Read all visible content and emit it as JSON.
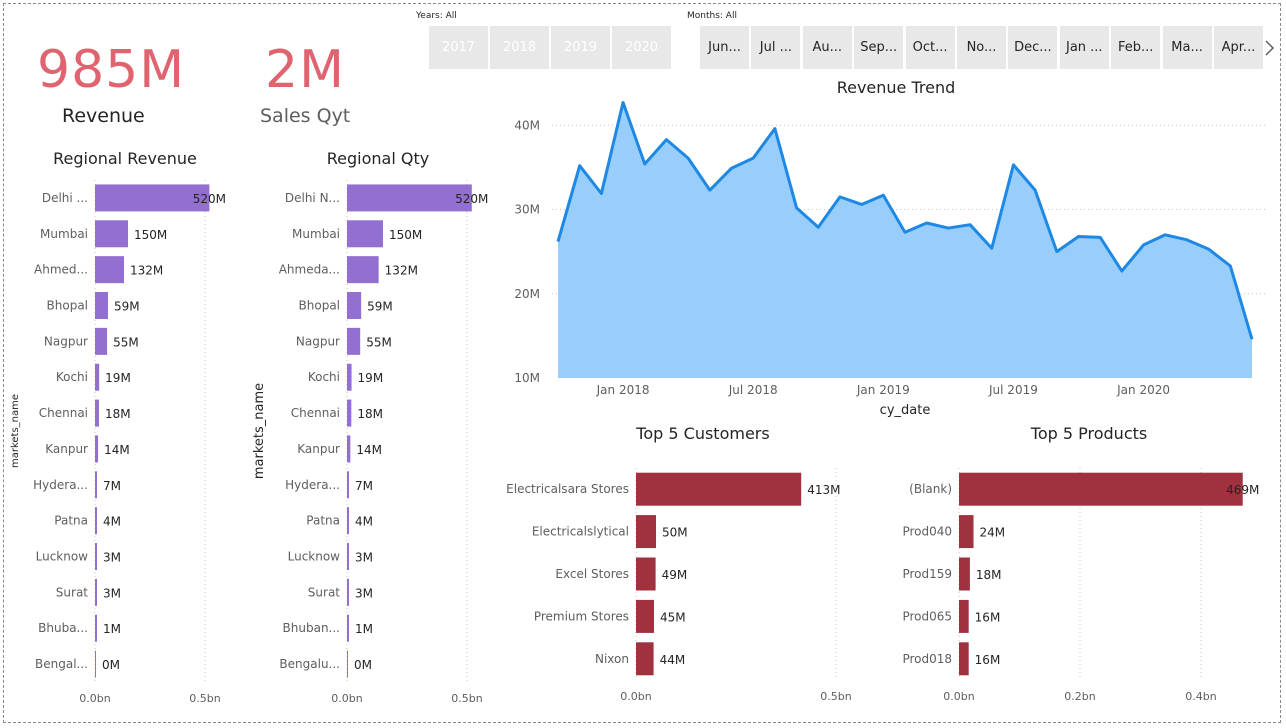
{
  "kpis": {
    "revenue": {
      "value": "985M",
      "label": "Revenue"
    },
    "sales_qty": {
      "value": "2M",
      "label": "Sales Qyt"
    }
  },
  "slicers": {
    "years": {
      "title": "Years: All",
      "items": [
        "2017",
        "2018",
        "2019",
        "2020"
      ]
    },
    "months": {
      "title": "Months: All",
      "items": [
        "Jun...",
        "Jul ...",
        "Au...",
        "Sep...",
        "Oct...",
        "No...",
        "Dec...",
        "Jan ...",
        "Feb...",
        "Ma...",
        "Apr..."
      ],
      "next_icon": "chevron-right-icon"
    }
  },
  "colors": {
    "kpi": "#e0646f",
    "regional_bar": "#9370d0",
    "top5_bar": "#a0313e",
    "area_fill": "#99cdfa",
    "area_line": "#1e88e5"
  },
  "chart_data": [
    {
      "id": "regional_revenue",
      "type": "bar",
      "orientation": "horizontal",
      "title": "Regional Revenue",
      "ylabel": "markets_name",
      "categories": [
        "Delhi ...",
        "Mumbai",
        "Ahmed...",
        "Bhopal",
        "Nagpur",
        "Kochi",
        "Chennai",
        "Kanpur",
        "Hydera...",
        "Patna",
        "Lucknow",
        "Surat",
        "Bhuba...",
        "Bengal..."
      ],
      "values": [
        520,
        150,
        132,
        59,
        55,
        19,
        18,
        14,
        7,
        4,
        3,
        3,
        1,
        0
      ],
      "data_labels": [
        "520M",
        "150M",
        "132M",
        "59M",
        "55M",
        "19M",
        "18M",
        "14M",
        "7M",
        "4M",
        "3M",
        "3M",
        "1M",
        "0M"
      ],
      "x_ticks": [
        "0.0bn",
        "0.5bn"
      ]
    },
    {
      "id": "regional_qty",
      "type": "bar",
      "orientation": "horizontal",
      "title": "Regional Qty",
      "ylabel": "markets_name",
      "categories": [
        "Delhi N...",
        "Mumbai",
        "Ahmeda...",
        "Bhopal",
        "Nagpur",
        "Kochi",
        "Chennai",
        "Kanpur",
        "Hydera...",
        "Patna",
        "Lucknow",
        "Surat",
        "Bhuban...",
        "Bengalu..."
      ],
      "values": [
        520,
        150,
        132,
        59,
        55,
        19,
        18,
        14,
        7,
        4,
        3,
        3,
        1,
        0
      ],
      "data_labels": [
        "520M",
        "150M",
        "132M",
        "59M",
        "55M",
        "19M",
        "18M",
        "14M",
        "7M",
        "4M",
        "3M",
        "3M",
        "1M",
        "0M"
      ],
      "x_ticks": [
        "0.0bn",
        "0.5bn"
      ]
    },
    {
      "id": "revenue_trend",
      "type": "area",
      "title": "Revenue Trend",
      "xlabel": "cy_date",
      "x": [
        "2017-10",
        "2017-11",
        "2017-12",
        "2018-01",
        "2018-02",
        "2018-03",
        "2018-04",
        "2018-05",
        "2018-06",
        "2018-07",
        "2018-08",
        "2018-09",
        "2018-10",
        "2018-11",
        "2018-12",
        "2019-01",
        "2019-02",
        "2019-03",
        "2019-04",
        "2019-05",
        "2019-06",
        "2019-07",
        "2019-08",
        "2019-09",
        "2019-10",
        "2019-11",
        "2019-12",
        "2020-01",
        "2020-02",
        "2020-03",
        "2020-04",
        "2020-05",
        "2020-06"
      ],
      "values": [
        26.2,
        35.2,
        31.9,
        42.7,
        35.4,
        38.3,
        36.1,
        32.3,
        34.9,
        36.1,
        39.6,
        30.2,
        27.9,
        31.5,
        30.6,
        31.7,
        27.3,
        28.4,
        27.8,
        28.2,
        25.4,
        35.3,
        32.3,
        25.0,
        26.8,
        26.7,
        22.7,
        25.8,
        27.0,
        26.4,
        25.3,
        23.3,
        14.6
      ],
      "ylim": [
        10,
        43
      ],
      "y_ticks": [
        "10M",
        "20M",
        "30M",
        "40M"
      ],
      "x_ticks": [
        "Jan 2018",
        "Jul 2018",
        "Jan 2019",
        "Jul 2019",
        "Jan 2020"
      ]
    },
    {
      "id": "top5_customers",
      "type": "bar",
      "orientation": "horizontal",
      "title": "Top 5 Customers",
      "categories": [
        "Electricalsara Stores",
        "Electricalslytical",
        "Excel Stores",
        "Premium Stores",
        "Nixon"
      ],
      "values": [
        413,
        50,
        49,
        45,
        44
      ],
      "data_labels": [
        "413M",
        "50M",
        "49M",
        "45M",
        "44M"
      ],
      "x_ticks": [
        "0.0bn",
        "0.5bn"
      ]
    },
    {
      "id": "top5_products",
      "type": "bar",
      "orientation": "horizontal",
      "title": "Top 5 Products",
      "categories": [
        "(Blank)",
        "Prod040",
        "Prod159",
        "Prod065",
        "Prod018"
      ],
      "values": [
        469,
        24,
        18,
        16,
        16
      ],
      "data_labels": [
        "469M",
        "24M",
        "18M",
        "16M",
        "16M"
      ],
      "x_ticks": [
        "0.0bn",
        "0.2bn",
        "0.4bn"
      ]
    }
  ]
}
